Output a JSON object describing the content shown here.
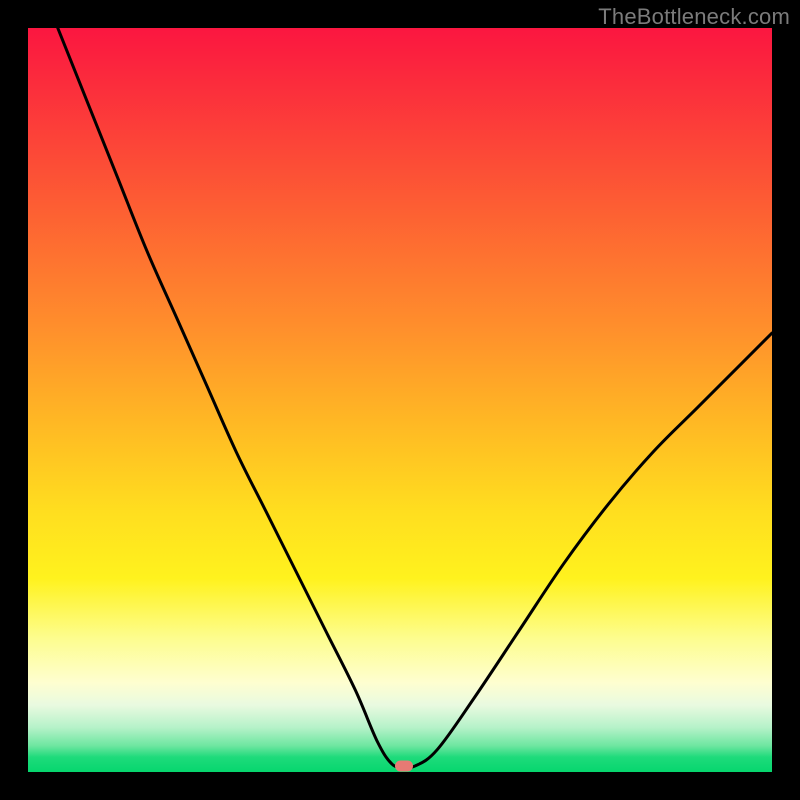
{
  "watermark": "TheBottleneck.com",
  "gradient_colors": {
    "top": "#fb1640",
    "mid1": "#ff8e2c",
    "mid2": "#ffde1f",
    "pale": "#fefed0",
    "bottom": "#06d66e"
  },
  "marker": {
    "color": "#e77a74",
    "x_frac": 0.505,
    "y_frac": 0.992
  },
  "chart_data": {
    "type": "line",
    "title": "",
    "xlabel": "",
    "ylabel": "",
    "xlim": [
      0,
      100
    ],
    "ylim": [
      0,
      100
    ],
    "grid": false,
    "legend": false,
    "series": [
      {
        "name": "bottleneck-curve",
        "x": [
          4,
          8,
          12,
          16,
          20,
          24,
          28,
          32,
          36,
          40,
          44,
          47,
          49,
          50.5,
          52,
          55,
          60,
          66,
          72,
          78,
          84,
          90,
          96,
          100
        ],
        "y": [
          100,
          90,
          80,
          70,
          61,
          52,
          43,
          35,
          27,
          19,
          11,
          4,
          1,
          0.8,
          0.8,
          3,
          10,
          19,
          28,
          36,
          43,
          49,
          55,
          59
        ]
      }
    ],
    "optimum_point": {
      "x": 50.5,
      "y": 0.8
    }
  }
}
